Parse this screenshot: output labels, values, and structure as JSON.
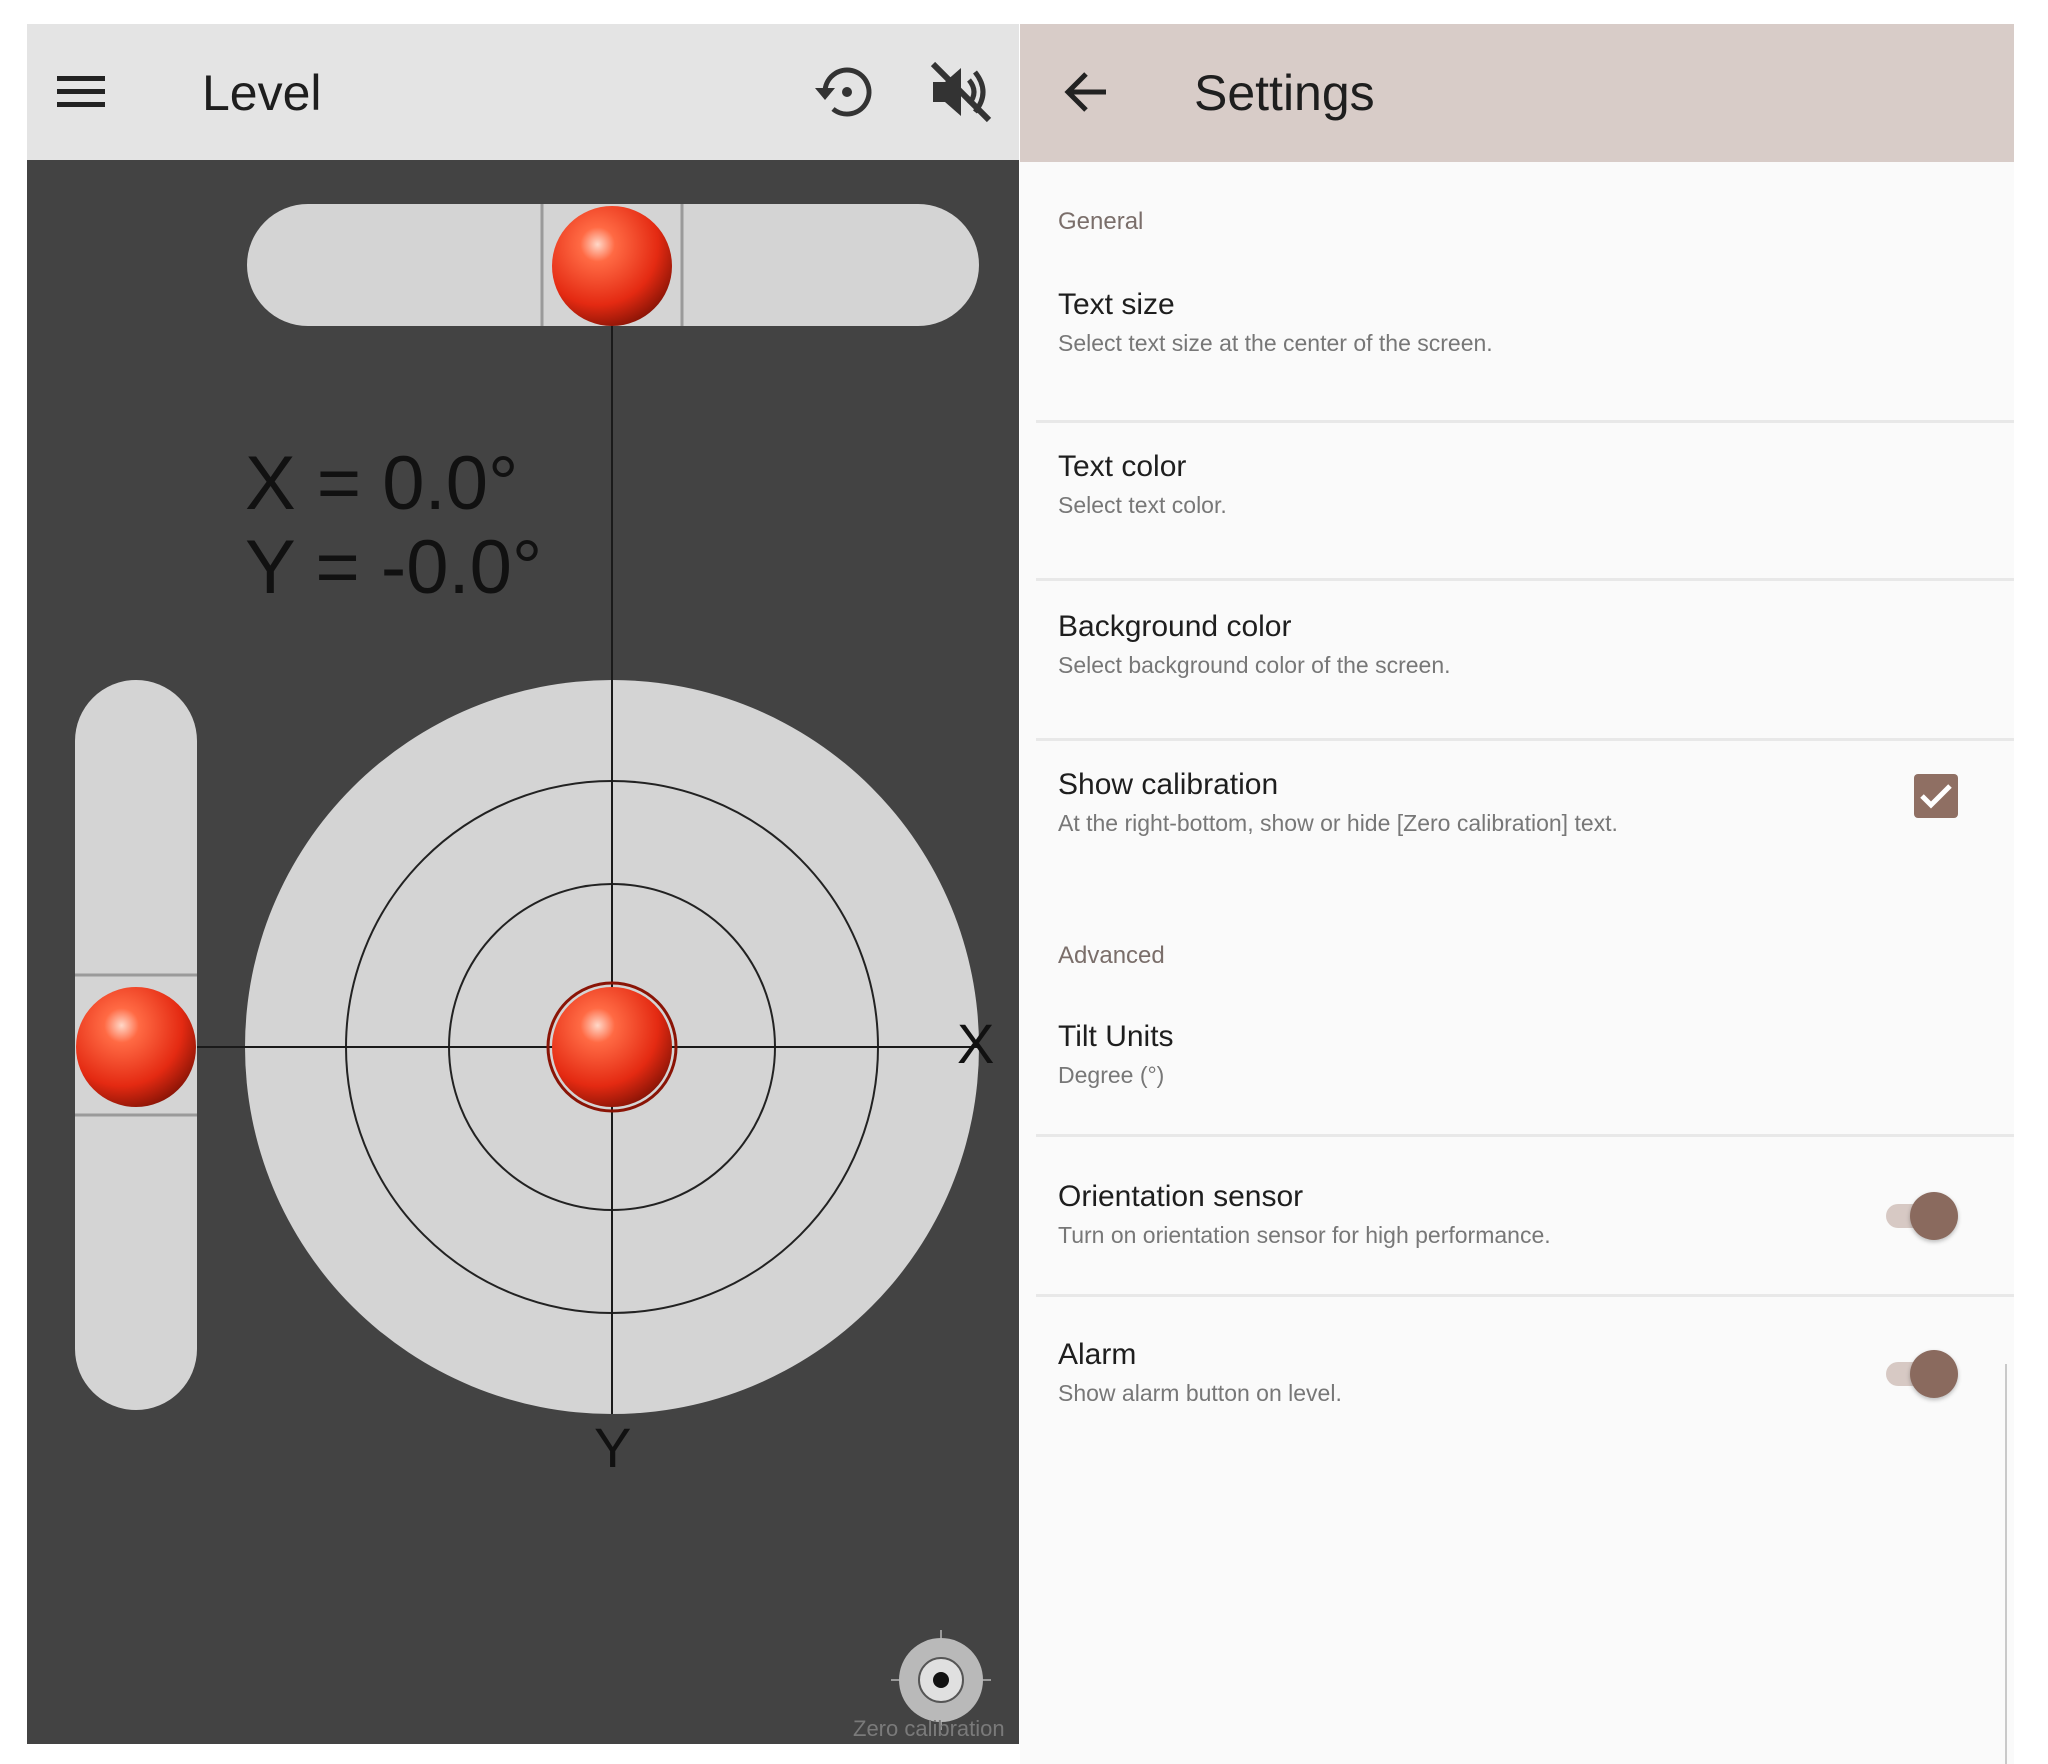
{
  "level": {
    "title": "Level",
    "menu_icon": "hamburger-menu-icon",
    "calibrate_icon": "history-calibrate-icon",
    "sound_icon": "volume-off-icon",
    "readout_x": "X = 0.0°",
    "readout_y": "Y = -0.0°",
    "x_axis_label": "X",
    "y_axis_label": "Y",
    "zero_calibration_label": "Zero calibration",
    "zero_calibration_icon": "target-crosshair-icon",
    "bubble_color": "#e8341c",
    "vial_color": "#d4d4d4",
    "background_color": "#434343"
  },
  "settings": {
    "title": "Settings",
    "back_icon": "arrow-back-icon",
    "accent_color": "#8a6a5e",
    "sections": {
      "general": "General",
      "advanced": "Advanced"
    },
    "items": {
      "text_size": {
        "title": "Text size",
        "summary": "Select text size at the center of the screen."
      },
      "text_color": {
        "title": "Text color",
        "summary": "Select text color."
      },
      "background_color": {
        "title": "Background color",
        "summary": "Select background color of the screen."
      },
      "show_calibration": {
        "title": "Show calibration",
        "summary": "At the right-bottom, show or hide [Zero calibration] text.",
        "checked": true
      },
      "tilt_units": {
        "title": "Tilt Units",
        "summary": "Degree (°)"
      },
      "orientation_sensor": {
        "title": "Orientation sensor",
        "summary": "Turn on orientation sensor for high performance.",
        "on": true
      },
      "alarm": {
        "title": "Alarm",
        "summary": "Show alarm button on level.",
        "on": true
      }
    }
  }
}
